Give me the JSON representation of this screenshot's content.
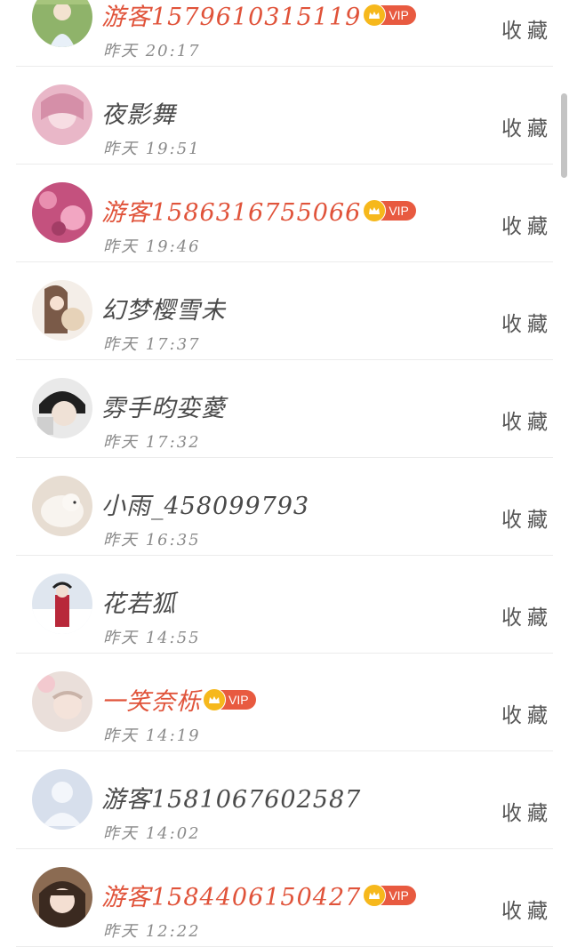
{
  "collect_label": "收藏",
  "vip_label": "VIP",
  "users": [
    {
      "name": "游客1579610315119",
      "time": "昨天 20:17",
      "vip": true
    },
    {
      "name": "夜影舞",
      "time": "昨天 19:51",
      "vip": false
    },
    {
      "name": "游客1586316755066",
      "time": "昨天 19:46",
      "vip": true
    },
    {
      "name": "幻梦樱雪未",
      "time": "昨天 17:37",
      "vip": false
    },
    {
      "name": "雰手昀娈薆",
      "time": "昨天 17:32",
      "vip": false
    },
    {
      "name": "小雨_458099793",
      "time": "昨天 16:35",
      "vip": false
    },
    {
      "name": "花若狐",
      "time": "昨天 14:55",
      "vip": false
    },
    {
      "name": "一笑奈栎",
      "time": "昨天 14:19",
      "vip": true
    },
    {
      "name": "游客1581067602587",
      "time": "昨天 14:02",
      "vip": false
    },
    {
      "name": "游客1584406150427",
      "time": "昨天 12:22",
      "vip": true
    }
  ],
  "colors": {
    "vip_name": "#e0533a",
    "vip_badge": "#e85a40",
    "crown": "#f6b81c"
  }
}
